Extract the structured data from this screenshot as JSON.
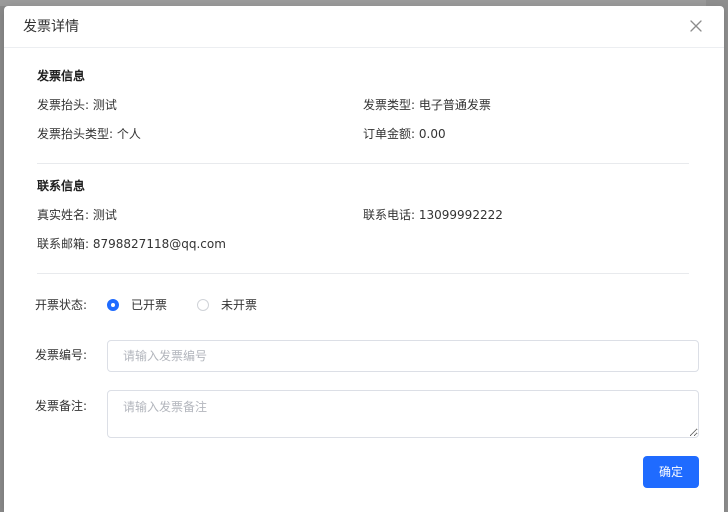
{
  "dialog": {
    "title": "发票详情",
    "close_icon": "close-icon"
  },
  "invoice_info": {
    "section_title": "发票信息",
    "title_label": "发票抬头:",
    "title_value": "测试",
    "type_label": "发票类型:",
    "type_value": "电子普通发票",
    "title_type_label": "发票抬头类型:",
    "title_type_value": "个人",
    "amount_label": "订单金额:",
    "amount_value": "0.00"
  },
  "contact_info": {
    "section_title": "联系信息",
    "name_label": "真实姓名:",
    "name_value": "测试",
    "phone_label": "联系电话:",
    "phone_value": "13099992222",
    "email_label": "联系邮箱:",
    "email_value": "8798827118@qq.com"
  },
  "form": {
    "status_label": "开票状态:",
    "status_options": [
      {
        "label": "已开票",
        "checked": true
      },
      {
        "label": "未开票",
        "checked": false
      }
    ],
    "number_label": "发票编号:",
    "number_placeholder": "请输入发票编号",
    "number_value": "",
    "remark_label": "发票备注:",
    "remark_placeholder": "请输入发票备注",
    "remark_value": ""
  },
  "footer": {
    "confirm_label": "确定"
  },
  "colors": {
    "primary": "#1f6bff",
    "overlay": "#8a8a8a"
  }
}
